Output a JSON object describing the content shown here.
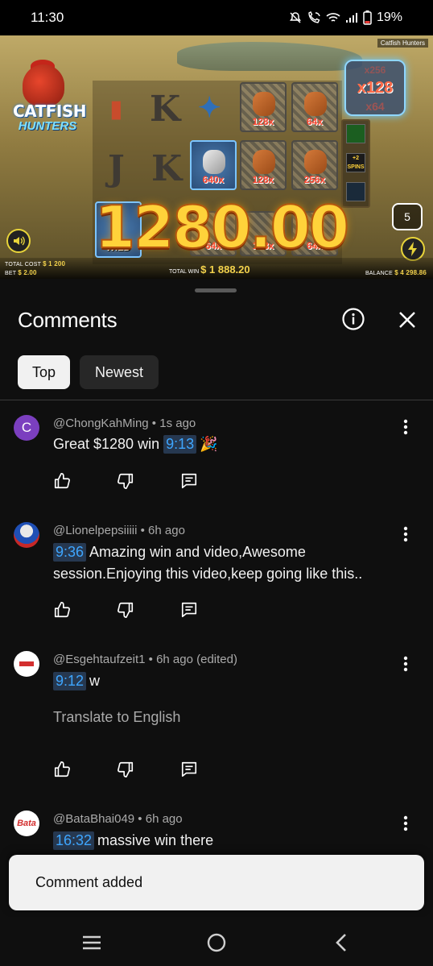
{
  "status_bar": {
    "time": "11:30",
    "battery": "19%",
    "icons": [
      "mute-icon",
      "wifi-calling-icon",
      "wifi-icon",
      "signal-icon",
      "battery-icon"
    ]
  },
  "video": {
    "game_tag": "Catfish Hunters",
    "logo_title": "CATFISH",
    "logo_subtitle": "HUNTERS",
    "big_win": "1280.00",
    "multiplier_top": "x256",
    "multiplier_main": "x128",
    "multiplier_sub": "x64",
    "cells": [
      "128x",
      "64x",
      "640x",
      "128x",
      "256x",
      "64x",
      "128x",
      "64x"
    ],
    "wild_label": "WILD",
    "spins_label": "+2 SPINS",
    "spin_count": "5",
    "total_cost_label": "TOTAL COST",
    "total_cost_value": "$ 1 200",
    "bet_label": "BET",
    "bet_value": "$ 2.00",
    "total_win_label": "TOTAL WIN",
    "total_win_value": "$ 1 888.20",
    "balance_label": "BALANCE",
    "balance_value": "$ 4 298.86"
  },
  "sheet": {
    "title": "Comments",
    "filters": [
      "Top",
      "Newest"
    ],
    "active_filter": "Top"
  },
  "comments": [
    {
      "author": "@ChongKahMing",
      "age": "1s ago",
      "avatar_letter": "C",
      "avatar_color": "#7b3fbf",
      "timestamp": "9:13",
      "text": "Great $1280 win",
      "emoji": "🎉"
    },
    {
      "author": "@Lionelpepsiiiii",
      "age": "6h ago",
      "timestamp": "9:36",
      "text_before": "Amazing win and video,Awesome",
      "text_line2": "session.Enjoying this video,keep going like this.."
    },
    {
      "author": "@Esgehtaufzeit1",
      "age": "6h ago (edited)",
      "timestamp": "9:12",
      "text": "w",
      "translate": "Translate to English"
    },
    {
      "author": "@BataBhai049",
      "age": "6h ago",
      "timestamp": "16:32",
      "text": "massive win there"
    }
  ],
  "toast": {
    "text": "Comment added"
  },
  "colors": {
    "background": "#0f0f0f",
    "timestamp_link": "#3ea6ff",
    "timestamp_bg": "#263850",
    "chip_active": "#f1f1f1",
    "chip_inactive": "#272727"
  }
}
